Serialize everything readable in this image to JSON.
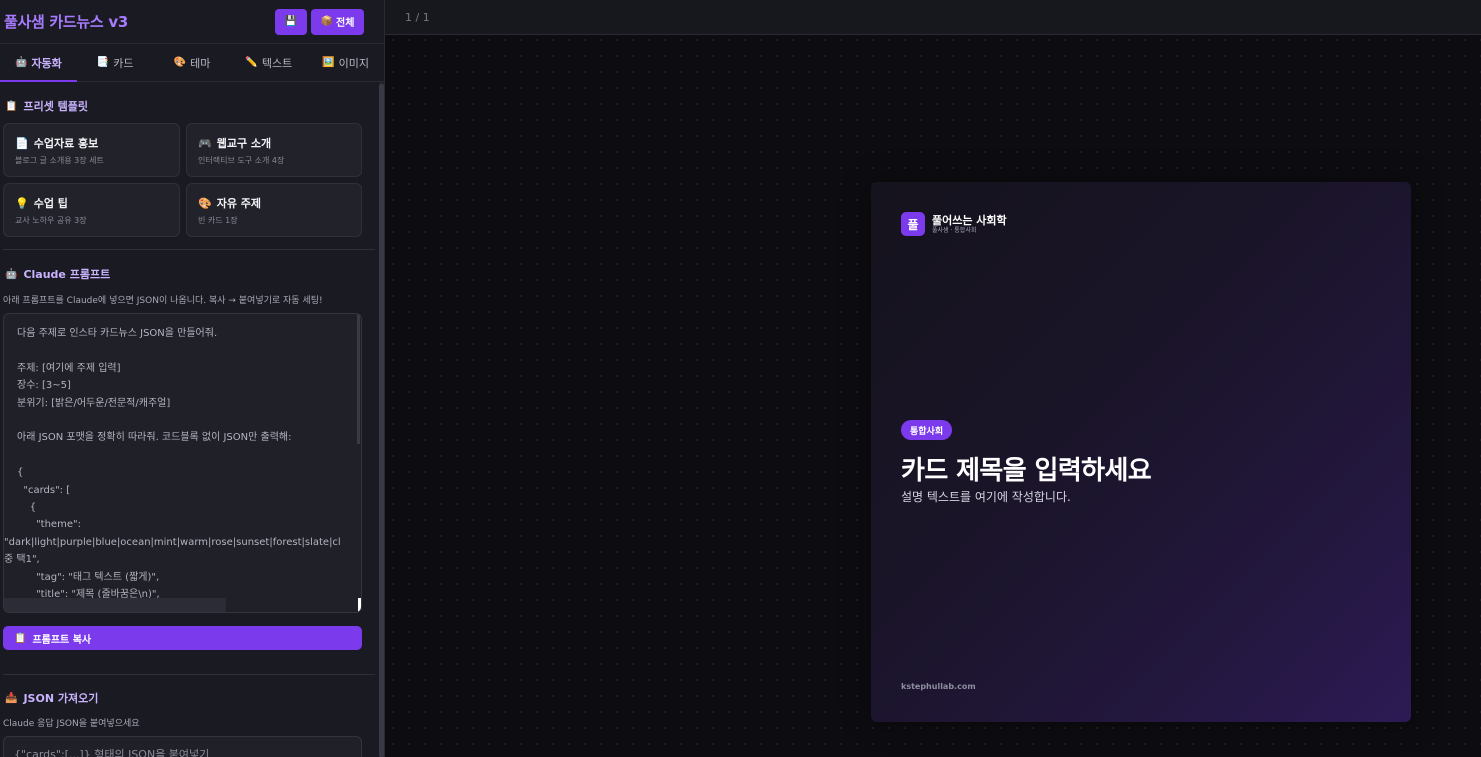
{
  "app": {
    "title": "풀사샘 카드뉴스 v3",
    "save_icon": "💾",
    "all_button": {
      "icon": "📦",
      "label": "전체"
    }
  },
  "tabs": [
    {
      "icon": "🤖",
      "label": "자동화",
      "active": true
    },
    {
      "icon": "📑",
      "label": "카드",
      "active": false
    },
    {
      "icon": "🎨",
      "label": "테마",
      "active": false
    },
    {
      "icon": "✏️",
      "label": "텍스트",
      "active": false
    },
    {
      "icon": "🖼️",
      "label": "이미지",
      "active": false
    }
  ],
  "presets": {
    "icon": "📋",
    "title": "프리셋 템플릿",
    "items": [
      {
        "icon": "📄",
        "name": "수업자료 홍보",
        "desc": "블로그 글 소개용 3장 세트"
      },
      {
        "icon": "🎮",
        "name": "웹교구 소개",
        "desc": "인터랙티브 도구 소개 4장"
      },
      {
        "icon": "💡",
        "name": "수업 팁",
        "desc": "교사 노하우 공유 3장"
      },
      {
        "icon": "🎨",
        "name": "자유 주제",
        "desc": "빈 카드 1장"
      }
    ]
  },
  "claude": {
    "icon": "🤖",
    "title": "Claude 프롬프트",
    "hint": "아래 프롬프트를 Claude에 넣으면 JSON이 나옵니다. 복사 → 붙여넣기로 자동 세팅!",
    "prompt_lines": [
      "다음 주제로 인스타 카드뉴스 JSON을 만들어줘.",
      "",
      "주제: [여기에 주제 입력]",
      "장수: [3~5]",
      "분위기: [밝은/어두운/전문적/캐주얼]",
      "",
      "아래 JSON 포맷을 정확히 따라줘. 코드블록 없이 JSON만 출력해:",
      "",
      "{",
      "  \"cards\": [",
      "    {",
      "      \"theme\":",
      "\"dark|light|purple|blue|ocean|mint|warm|rose|sunset|forest|slate|cl",
      "중 택1\",",
      "      \"tag\": \"태그 텍스트 (짧게)\",",
      "      \"title\": \"제목 (줄바꿈은\\n)\","
    ],
    "copy_button": {
      "icon": "📋",
      "label": "프롬프트 복사"
    }
  },
  "json_import": {
    "icon": "📥",
    "title": "JSON 가져오기",
    "hint": "Claude 응답 JSON을 붙여넣으세요",
    "placeholder": "{\"cards\":[...]} 형태의 JSON을 붙여넣기"
  },
  "canvas": {
    "page_counter": "1 / 1",
    "card": {
      "brand_logo": "풀",
      "brand_name": "풀어쓰는 사회학",
      "brand_sub": "풀사샘 · 통합사회",
      "tag": "통합사회",
      "title": "카드 제목을 입력하세요",
      "description": "설명 텍스트를 여기에 작성합니다.",
      "footer": "kstephullab.com"
    }
  },
  "colors": {
    "accent": "#7c3aed",
    "accent_text": "#c9b3ff",
    "sidebar_bg": "#1a1a22",
    "canvas_bg": "#0d0d11"
  }
}
